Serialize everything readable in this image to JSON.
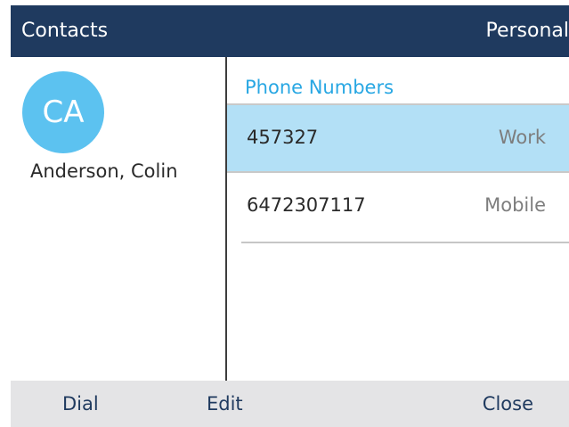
{
  "header": {
    "title": "Contacts",
    "right_label": "Personal"
  },
  "contact": {
    "avatar_initials": "CA",
    "name": "Anderson, Colin"
  },
  "phone_section": {
    "label": "Phone Numbers",
    "numbers": [
      {
        "number": "457327",
        "type": "Work",
        "selected": true
      },
      {
        "number": "6472307117",
        "type": "Mobile",
        "selected": false
      }
    ]
  },
  "softkeys": {
    "dial": "Dial",
    "edit": "Edit",
    "close": "Close"
  },
  "colors": {
    "header_bg": "#1f3a5f",
    "avatar_bg": "#5cc2f0",
    "accent_text": "#28a7e3",
    "selected_row_bg": "#b3e0f6",
    "softkey_bg": "#e4e4e6"
  }
}
